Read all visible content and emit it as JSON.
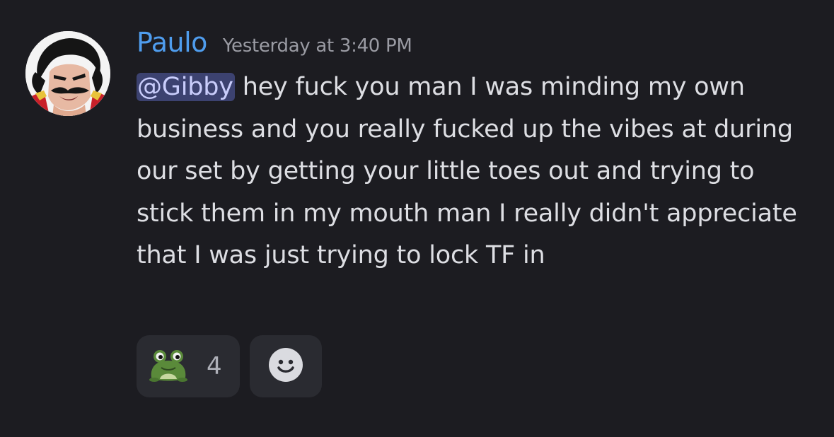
{
  "message": {
    "author": "Paulo",
    "author_color": "#4f9dee",
    "timestamp": "Yesterday at 3:40 PM",
    "mention": "@Gibby",
    "body": " hey fuck you man I was minding my own business and you really fucked up the vibes at during our set by getting your little toes out and trying to stick them in my mouth man I really didn't appreciate that I was just trying to lock TF in"
  },
  "reactions": [
    {
      "emoji": "frog-emoji",
      "count": "4"
    }
  ],
  "add_reaction_icon": "smiley-icon"
}
